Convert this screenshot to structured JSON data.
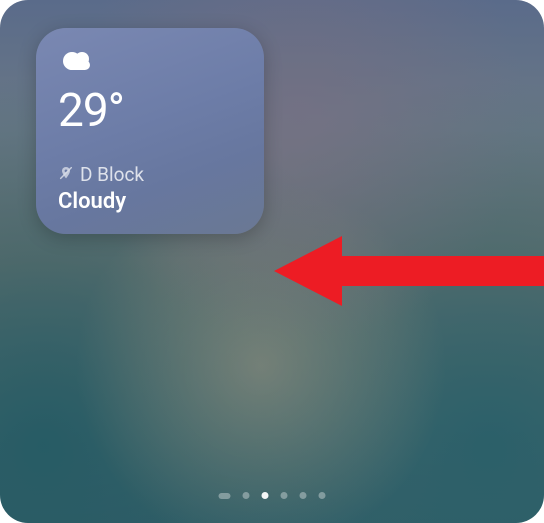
{
  "weather": {
    "temperature": "29°",
    "location": "D Block",
    "condition": "Cloudy",
    "icon": "cloud-icon"
  },
  "pagination": {
    "total_pages": 5,
    "active_index": 1,
    "has_search_pill": true
  },
  "annotation": {
    "arrow_color": "#ED1C24"
  }
}
